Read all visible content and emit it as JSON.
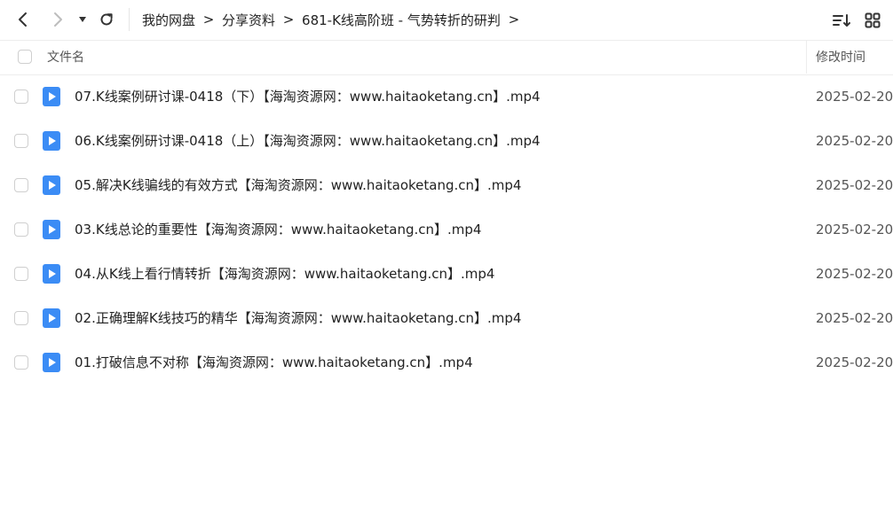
{
  "toolbar": {
    "back_icon": "chevron-left-icon",
    "forward_icon": "chevron-right-icon",
    "dropdown_icon": "caret-down-icon",
    "refresh_icon": "refresh-icon",
    "sort_icon": "sort-icon",
    "grid_view_icon": "grid-view-icon"
  },
  "breadcrumb": {
    "items": [
      "我的网盘",
      "分享资料",
      "681-K线高阶班 - 气势转折的研判"
    ],
    "separator": ">"
  },
  "table": {
    "columns": {
      "name": "文件名",
      "modified": "修改时间"
    },
    "rows": [
      {
        "name": "07.K线案例研讨课-0418（下）【海淘资源网：www.haitaoketang.cn】.mp4",
        "modified": "2025-02-20"
      },
      {
        "name": "06.K线案例研讨课-0418（上）【海淘资源网：www.haitaoketang.cn】.mp4",
        "modified": "2025-02-20"
      },
      {
        "name": "05.解决K线骗线的有效方式【海淘资源网：www.haitaoketang.cn】.mp4",
        "modified": "2025-02-20"
      },
      {
        "name": "03.K线总论的重要性【海淘资源网：www.haitaoketang.cn】.mp4",
        "modified": "2025-02-20"
      },
      {
        "name": "04.从K线上看行情转折【海淘资源网：www.haitaoketang.cn】.mp4",
        "modified": "2025-02-20"
      },
      {
        "name": "02.正确理解K线技巧的精华【海淘资源网：www.haitaoketang.cn】.mp4",
        "modified": "2025-02-20"
      },
      {
        "name": "01.打破信息不对称【海淘资源网：www.haitaoketang.cn】.mp4",
        "modified": "2025-02-20"
      }
    ]
  },
  "colors": {
    "video_icon": "#3b8cf5",
    "border": "#ededed",
    "text": "#222222",
    "muted": "#555555"
  }
}
